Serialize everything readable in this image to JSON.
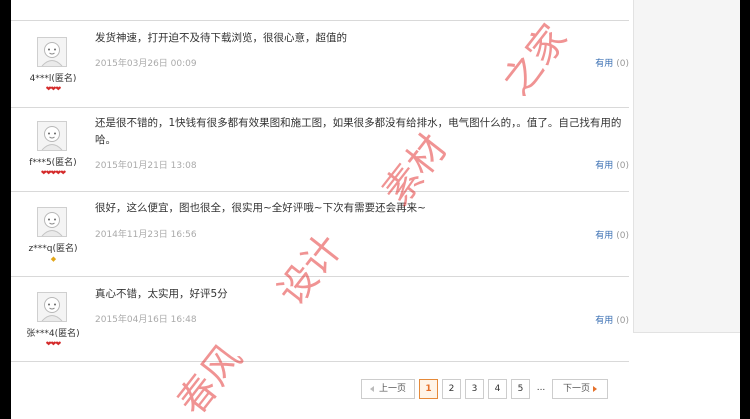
{
  "reviews": [
    {
      "user": "4***l(匿名)",
      "content": "发货神速，打开迫不及待下载浏览，很很心意，超值的",
      "date": "2015年03月26日 00:09",
      "stars": "❤❤❤",
      "star_color": "#d42a2a",
      "useful_label": "有用",
      "useful_count": "(0)"
    },
    {
      "user": "f***5(匿名)",
      "content": "还是很不错的，1快钱有很多都有效果图和施工图，如果很多都没有给排水，电气图什么的，。值了。自己找有用的哈。",
      "date": "2015年01月21日 13:08",
      "stars": "❤❤❤❤❤",
      "star_color": "#d42a2a",
      "useful_label": "有用",
      "useful_count": "(0)"
    },
    {
      "user": "z***q(匿名)",
      "content": "很好，这么便宜，图也很全，很实用~全好评哦~下次有需要还会再来~",
      "date": "2014年11月23日 16:56",
      "stars": "◆",
      "star_color": "#e3a719",
      "useful_label": "有用",
      "useful_count": "(0)"
    },
    {
      "user": "张***4(匿名)",
      "content": "真心不错，太实用，好评5分",
      "date": "2015年04月16日 16:48",
      "stars": "❤❤❤",
      "star_color": "#d42a2a",
      "useful_label": "有用",
      "useful_count": "(0)"
    }
  ],
  "pagination": {
    "prev_label": "上一页",
    "pages": [
      "1",
      "2",
      "3",
      "4",
      "5"
    ],
    "current": "1",
    "ellipsis": "...",
    "next_label": "下一页"
  },
  "watermark": {
    "chars": [
      "春风",
      "设计",
      "素材",
      "之家"
    ],
    "color": "#e22828"
  }
}
